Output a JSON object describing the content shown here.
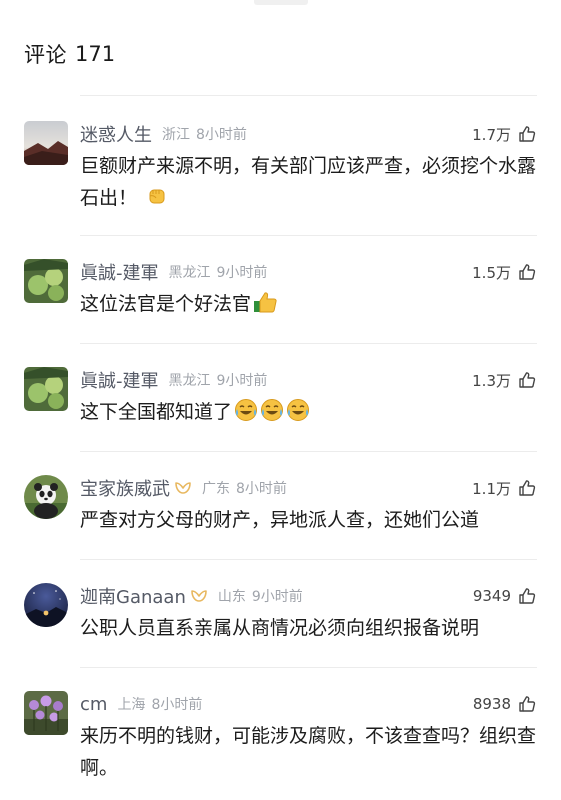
{
  "header": {
    "title": "评论",
    "count": "171"
  },
  "comments": [
    {
      "user": "迷惑人生",
      "location": "浙江",
      "time": "8小时前",
      "likes": "1.7万",
      "text": "巨额财产来源不明，有关部门应该严查，必须挖个水露石出！",
      "emoji": "fist-emoji"
    },
    {
      "user": "眞誠-建軍",
      "location": "黑龙江",
      "time": "9小时前",
      "likes": "1.5万",
      "text": "这位法官是个好法官",
      "emoji": "thumbs-up-emoji"
    },
    {
      "user": "眞誠-建軍",
      "location": "黑龙江",
      "time": "9小时前",
      "likes": "1.3万",
      "text": "这下全国都知道了",
      "emoji": "crying-laughing-emoji"
    },
    {
      "user": "宝家族威武",
      "location": "广东",
      "time": "8小时前",
      "likes": "1.1万",
      "text": "严查对方父母的财产，异地派人查，还她们公道",
      "badge": "fan-badge-icon"
    },
    {
      "user": "迦南Ganaan",
      "location": "山东",
      "time": "9小时前",
      "likes": "9349",
      "text": "公职人员直系亲属从商情况必须向组织报备说明",
      "badge": "fan-badge-icon"
    },
    {
      "user": "cm",
      "location": "上海",
      "time": "8小时前",
      "likes": "8938",
      "text": "来历不明的钱财，可能涉及腐败，不该查查吗？组织查啊。"
    }
  ],
  "colors": {
    "name": "#555a66",
    "meta": "#a0a4ab",
    "text": "#1c1c1c",
    "badge": "#e8b860"
  }
}
